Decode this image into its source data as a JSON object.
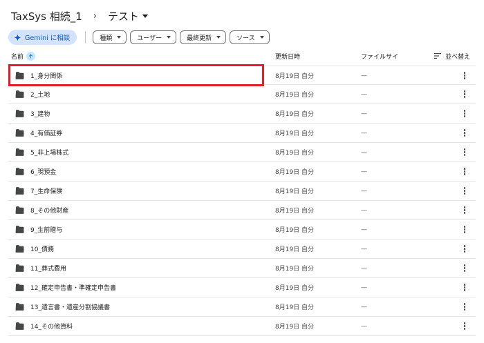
{
  "breadcrumb": {
    "root": "TaxSys 相続_1",
    "separator": "›",
    "current": "テスト"
  },
  "toolbar": {
    "gemini_label": "Gemini に相談",
    "filters": [
      "種類",
      "ユーザー",
      "最終更新",
      "ソース"
    ]
  },
  "columns": {
    "name": "名前",
    "modified": "更新日時",
    "size": "ファイルサイ",
    "sort": "並べ替え"
  },
  "files": [
    {
      "name": "1_身分関係",
      "modified": "8月19日 自分",
      "size": "—"
    },
    {
      "name": "2_土地",
      "modified": "8月19日 自分",
      "size": "—"
    },
    {
      "name": "3_建物",
      "modified": "8月19日 自分",
      "size": "—"
    },
    {
      "name": "4_有価証券",
      "modified": "8月19日 自分",
      "size": "—"
    },
    {
      "name": "5_非上場株式",
      "modified": "8月19日 自分",
      "size": "—"
    },
    {
      "name": "6_現預金",
      "modified": "8月19日 自分",
      "size": "—"
    },
    {
      "name": "7_生命保険",
      "modified": "8月19日 自分",
      "size": "—"
    },
    {
      "name": "8_その他財産",
      "modified": "8月19日 自分",
      "size": "—"
    },
    {
      "name": "9_生前贈与",
      "modified": "8月19日 自分",
      "size": "—"
    },
    {
      "name": "10_債務",
      "modified": "8月19日 自分",
      "size": "—"
    },
    {
      "name": "11_葬式費用",
      "modified": "8月19日 自分",
      "size": "—"
    },
    {
      "name": "12_確定申告書・準確定申告書",
      "modified": "8月19日 自分",
      "size": "—"
    },
    {
      "name": "13_遺言書・遺産分割協議書",
      "modified": "8月19日 自分",
      "size": "—"
    },
    {
      "name": "14_その他資料",
      "modified": "8月19日 自分",
      "size": "—"
    }
  ],
  "colors": {
    "accent": "#0b57d0",
    "gemini_bg": "#d3e3fd",
    "highlight": "#e41e26"
  },
  "icons": {
    "gemini": "sparkle-icon",
    "sort_direction": "arrow-up-icon",
    "sort_menu": "sort-lines-icon",
    "folder": "folder-icon",
    "more": "more-vert-icon"
  }
}
